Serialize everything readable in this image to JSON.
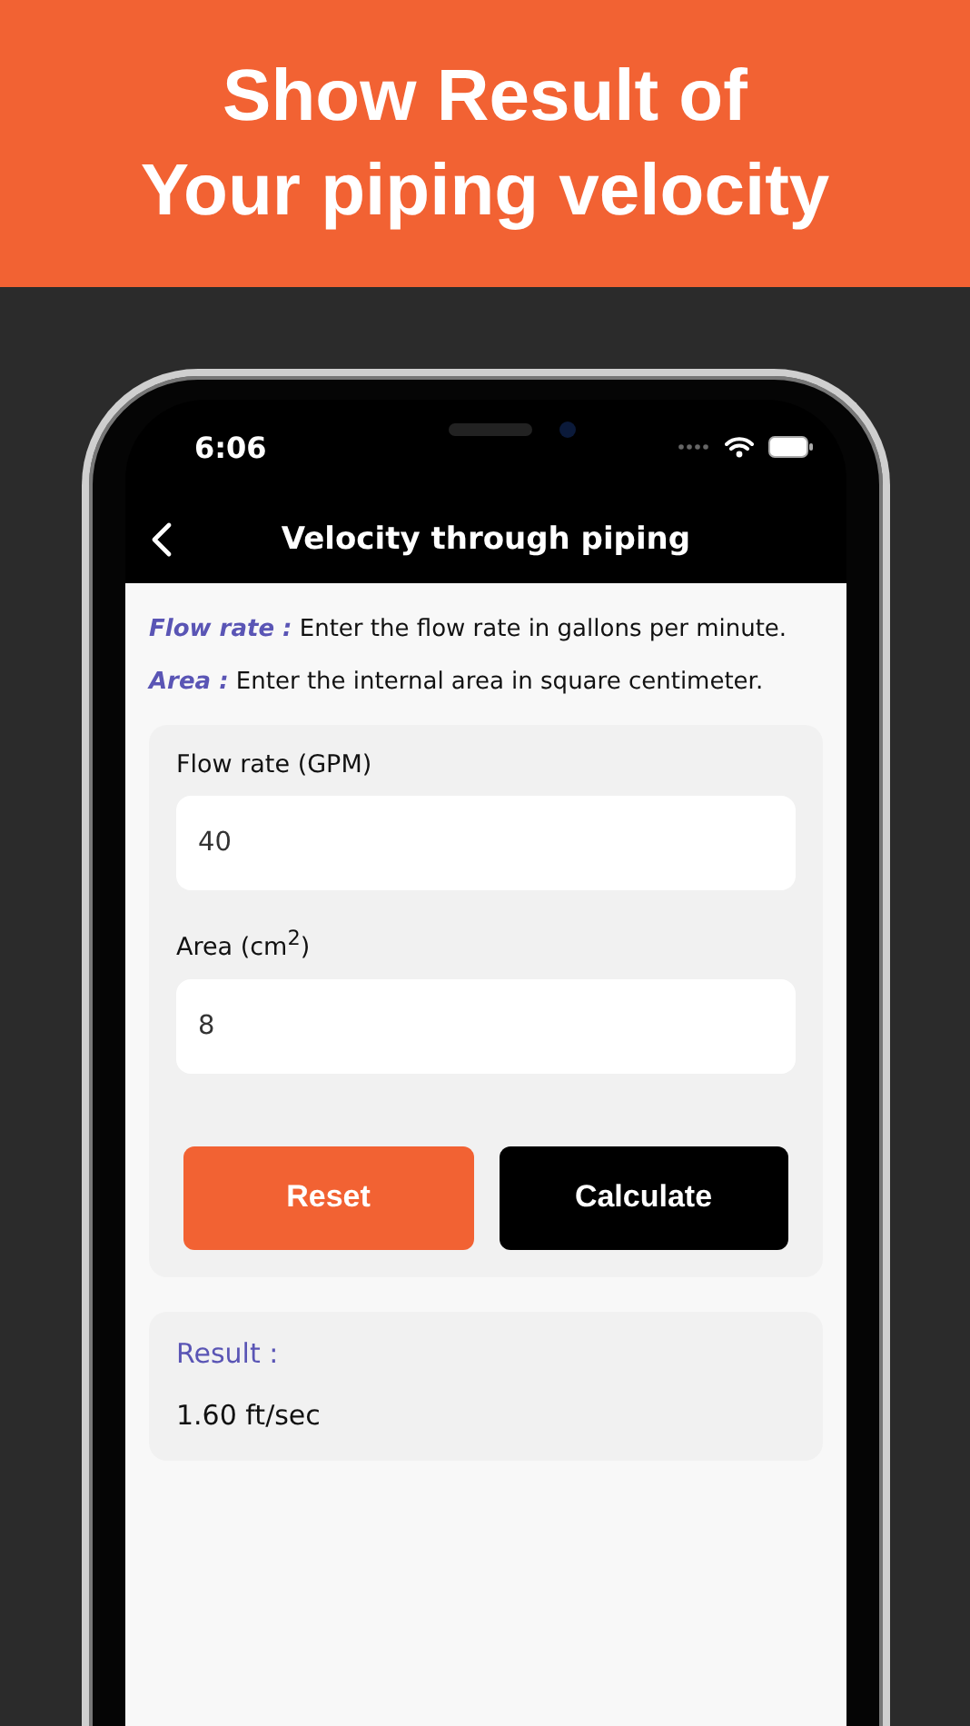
{
  "banner": {
    "lines": [
      "Show Result of",
      "Your piping velocity"
    ]
  },
  "status_bar": {
    "time": "6:06"
  },
  "nav": {
    "title": "Velocity through piping"
  },
  "instructions": [
    {
      "term": "Flow rate :",
      "text": "Enter the flow rate in gallons per minute."
    },
    {
      "term": "Area :",
      "text": "Enter the internal area in square centimeter."
    }
  ],
  "fields": [
    {
      "label": "Flow rate (GPM)",
      "value": "40"
    },
    {
      "label": "Area (cm$^{2}$)",
      "value": "8"
    }
  ],
  "buttons": [
    {
      "label": "Reset",
      "kind": "secondary"
    },
    {
      "label": "Calculate",
      "kind": "primary"
    }
  ],
  "result": {
    "label": "Result :",
    "value": "1.60 ft/sec"
  }
}
